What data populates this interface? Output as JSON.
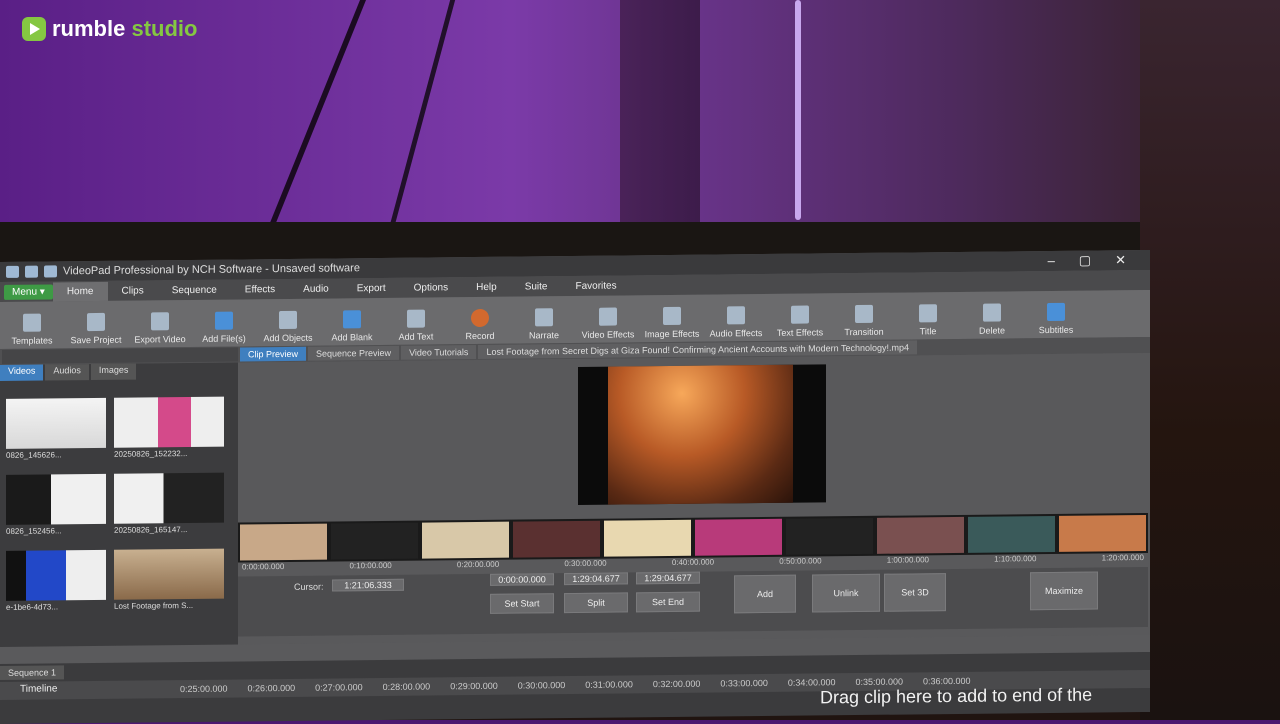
{
  "brand": {
    "rumble": "rumble",
    "studio": "studio"
  },
  "window": {
    "title": "VideoPad Professional by NCH Software - Unsaved software",
    "controls": [
      "–",
      "▢",
      "✕"
    ]
  },
  "menubar": {
    "menu_label": "Menu ▾",
    "items": [
      "Home",
      "Clips",
      "Sequence",
      "Effects",
      "Audio",
      "Export",
      "Options",
      "Help",
      "Suite",
      "Favorites"
    ]
  },
  "toolbar": {
    "items": [
      "Templates",
      "Save Project",
      "Export Video",
      "Add File(s)",
      "Add Objects",
      "Add Blank",
      "Add Text",
      "Record",
      "Narrate",
      "Video Effects",
      "Image Effects",
      "Audio Effects",
      "Text Effects",
      "Transition",
      "Title",
      "Delete",
      "Subtitles"
    ]
  },
  "preview_tabs": [
    "Clip Preview",
    "Sequence Preview",
    "Video Tutorials",
    "Lost Footage from Secret Digs at Giza Found! Confirming Ancient Accounts with Modern Technology!.mp4"
  ],
  "library": {
    "tabs": [
      "Videos",
      "Audios",
      "Images"
    ],
    "thumbs": [
      "0826_145626...",
      "20250826_152232...",
      "0826_152456...",
      "20250826_165147...",
      "e-1be6-4d73...",
      "Lost Footage from S..."
    ]
  },
  "ruler_marks": [
    "0:00:00.000",
    "0:10:00.000",
    "0:20:00.000",
    "0:30:00.000",
    "0:40:00.000",
    "0:50:00.000",
    "1:00:00.000",
    "1:10:00.000",
    "1:20:00.000"
  ],
  "controls": {
    "cursor_label": "Cursor:",
    "cursor_value": "1:21:06.333",
    "start_value": "0:00:00.000",
    "duration_value": "1:29:04.677",
    "end_value": "1:29:04.677",
    "set_start": "Set Start",
    "split": "Split",
    "set_end": "Set End",
    "add": "Add",
    "unlink": "Unlink",
    "set_3d": "Set 3D",
    "maximize": "Maximize"
  },
  "sequence": {
    "tab": "Sequence 1",
    "timeline_label": "Timeline",
    "ruler": [
      "0:25:00.000",
      "0:26:00.000",
      "0:27:00.000",
      "0:28:00.000",
      "0:29:00.000",
      "0:30:00.000",
      "0:31:00.000",
      "0:32:00.000",
      "0:33:00.000",
      "0:34:00.000",
      "0:35:00.000",
      "0:36:00.000"
    ],
    "drop_hint": "Drag clip here to add to end of the"
  }
}
